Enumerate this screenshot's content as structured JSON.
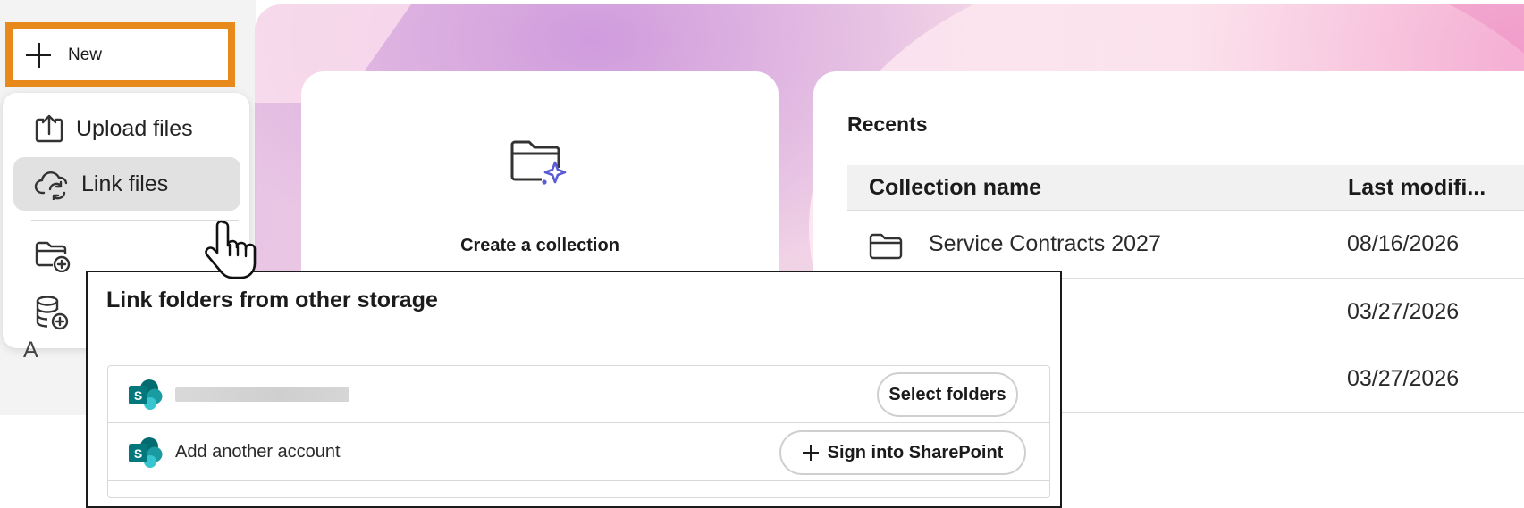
{
  "new_button": {
    "label": "New"
  },
  "menu": {
    "items": [
      {
        "label": "Upload files",
        "icon": "upload-icon"
      },
      {
        "label": "Link files",
        "icon": "cloud-sync-icon",
        "hovered": true
      }
    ],
    "extra_icons": [
      "folder-add-icon",
      "database-add-icon"
    ],
    "partial_text": "A"
  },
  "create_card": {
    "title": "Create a collection",
    "icon": "folder-sparkle-icon"
  },
  "recents": {
    "title": "Recents",
    "columns": [
      "Collection name",
      "Last modifi..."
    ],
    "rows": [
      {
        "name": "Service Contracts 2027",
        "date": "08/16/2026"
      },
      {
        "name": "",
        "date": "03/27/2026"
      },
      {
        "name": "",
        "date": "03/27/2026"
      }
    ]
  },
  "link_popup": {
    "title": "Link folders from other storage",
    "accounts": [
      {
        "icon": "sharepoint-icon",
        "name_redacted": true,
        "action": "Select folders"
      },
      {
        "icon": "sharepoint-icon",
        "label": "Add another account",
        "action": "Sign into SharePoint"
      }
    ]
  },
  "colors": {
    "highlight_border": "#e8891c",
    "sparkle_accent": "#5b5bd6",
    "sharepoint_teal": "#0b7a78"
  }
}
